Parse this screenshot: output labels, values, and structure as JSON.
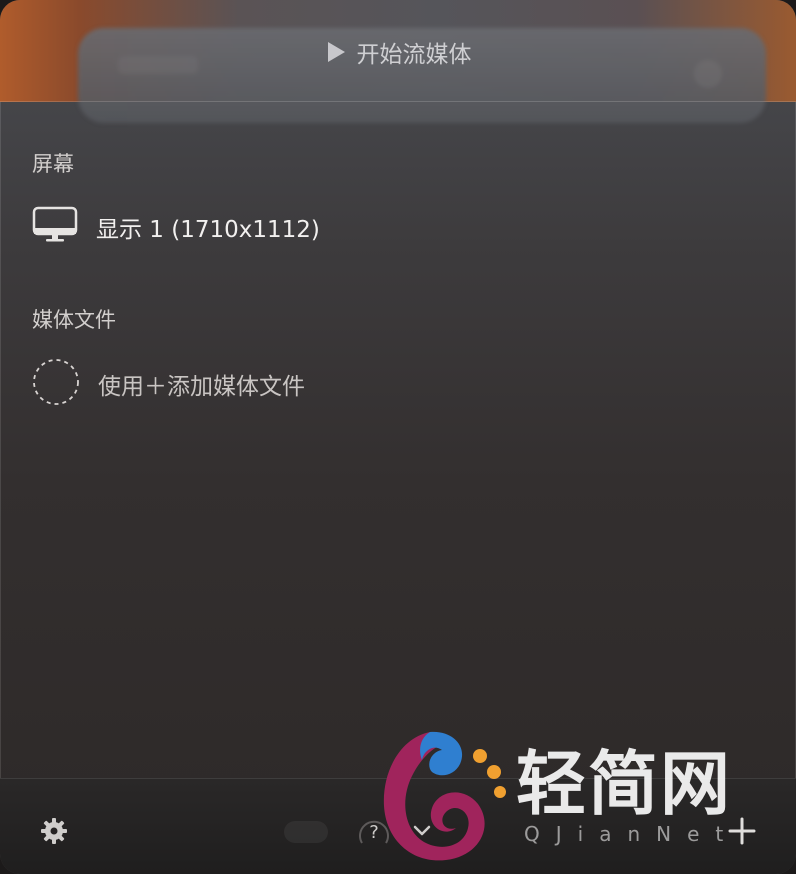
{
  "header": {
    "title": "开始流媒体",
    "play_icon": "play-icon"
  },
  "screens": {
    "label": "屏幕",
    "items": [
      {
        "label": "显示 1 (1710x1112)",
        "icon": "monitor-icon"
      }
    ]
  },
  "media_files": {
    "label": "媒体文件",
    "hint": "使用＋添加媒体文件",
    "icon": "dashed-circle-icon"
  },
  "footer": {
    "settings_icon": "gear-icon",
    "help_icon": "help-icon",
    "chevron_icon": "chevron-down-icon",
    "add_icon": "plus-icon"
  },
  "watermark": {
    "text": "轻简网",
    "sub": "QJianNet"
  },
  "colors": {
    "accent_orange": "#b05c2c",
    "logo_blue": "#2f7fd0",
    "logo_magenta": "#a0245c",
    "logo_orange": "#f0a030"
  }
}
